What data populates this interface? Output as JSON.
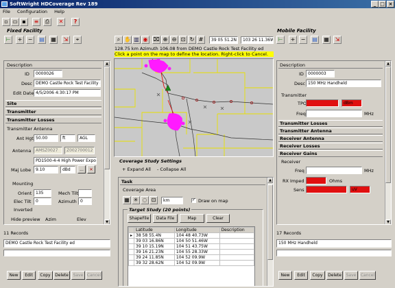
{
  "window": {
    "title": "SoftWright HDCoverage Rev 189",
    "minimize": "_",
    "maximize": "□",
    "close": "×"
  },
  "menu": [
    "File",
    "Configuration",
    "Help"
  ],
  "toolbar_main": [
    "new-icon",
    "open-icon",
    "save-icon",
    "settings-icon",
    "print-icon",
    "delete-icon",
    "help-icon"
  ],
  "fixed": {
    "title": "Fixed Facility",
    "description": {
      "section": "Description",
      "id_label": "ID",
      "id": "0000026",
      "desc_label": "Desc",
      "desc": "DEMO Castle Rock Test Facility ed",
      "edit_label": "Edit Date",
      "edit_date": "4/5/2006 4:30:17 PM"
    },
    "sections": [
      "Site",
      "Transmitter",
      "Transmitter Losses"
    ],
    "antenna": {
      "section": "Transmitter Antenna",
      "hgt_label": "Ant Hgt",
      "hgt": "50.00",
      "hgt_unit": "ft",
      "hgt_ref": "AGL",
      "antenna_label": "Antenna",
      "ant_code1": "AMSZ0027",
      "ant_code2": "Z002700012",
      "ant_model": "PD1500-4-4 High Power Expo",
      "lobe_label": "Maj Lobe",
      "lobe": "9.10",
      "lobe_unit": "dBd",
      "lobe_btn": "...",
      "mounting": "Mounting",
      "orient_label": "Orient",
      "orient": "135",
      "mech_label": "Mech Tilt",
      "elec_label": "Elec Tilt",
      "elec": "0",
      "azimuth_label": "Azimuth",
      "azimuth": "0",
      "inverted": "Inverted",
      "hide_preview": "Hide preview",
      "azim": "Azim",
      "elev": "Elev"
    },
    "records": "11 Records",
    "selected": "DEMO Castle Rock Test Facility ed",
    "buttons": [
      "New",
      "Edit",
      "Copy",
      "Delete",
      "Save",
      "Cancel"
    ]
  },
  "map": {
    "coord1": "39 05 51.2N",
    "coord2": "103 26 11.36W",
    "info": "128.75 km Azimuth 106.08 from DEMO Castle Rock Test Facility ed",
    "hint": "Click a point on the map to define the location.  Right-click to Cancel."
  },
  "study": {
    "title": "Coverage Study Settings",
    "expand": "+ Expand All",
    "collapse": "- Collapse All",
    "task": "Task",
    "coverage_area": "Coverage Area",
    "unit": "km",
    "draw_on_map": "Draw on map",
    "target_title": "Target Study (20 points)",
    "buttons": [
      "ShapeFile",
      "Data File",
      "Map",
      "Clear"
    ],
    "columns": [
      "Latitude",
      "Longitude",
      "Description"
    ],
    "rows": [
      [
        "38 58 55.4N",
        "104 48 40.73W",
        ""
      ],
      [
        "39 03 16.86N",
        "104 50 51.46W",
        ""
      ],
      [
        "39 10 15.19N",
        "104 51 43.75W",
        ""
      ],
      [
        "39 16 21.23N",
        "104 55 28.33W",
        ""
      ],
      [
        "39 24 11.85N",
        "104 52 09.9W",
        ""
      ],
      [
        "39 32 28.62N",
        "104 52 09.9W",
        ""
      ]
    ]
  },
  "mobile": {
    "title": "Mobile Facility",
    "description": {
      "section": "Description",
      "id_label": "ID",
      "id": "0000003",
      "desc_label": "Desc",
      "desc": "150 MHz Handheld"
    },
    "transmitter": {
      "section": "Transmitter",
      "tpo_label": "TPO",
      "tpo_unit": "dBm",
      "freq_label": "Freq",
      "freq_unit": "MHz"
    },
    "sections": [
      "Transmitter Losses",
      "Transmitter Antenna",
      "Receiver Antenna",
      "Receiver Losses",
      "Receiver Gains"
    ],
    "receiver": {
      "section": "Receiver",
      "freq_label": "Freq",
      "freq_unit": "MHz",
      "rx_label": "RX Imped",
      "rx_unit": "Ohms",
      "sens_label": "Sens",
      "sens_unit": "uV"
    },
    "records": "17 Records",
    "selected": "150 MHz Handheld",
    "buttons": [
      "New",
      "Edit",
      "Copy",
      "Delete",
      "Save",
      "Cancel"
    ]
  },
  "colors": {
    "title": "#0a246a",
    "urban": "#ff1aff",
    "map_bg": "#c9c9c9",
    "road_yellow": "#e8e000",
    "red_field": "#e01010",
    "hint_bg": "#ffff00"
  }
}
